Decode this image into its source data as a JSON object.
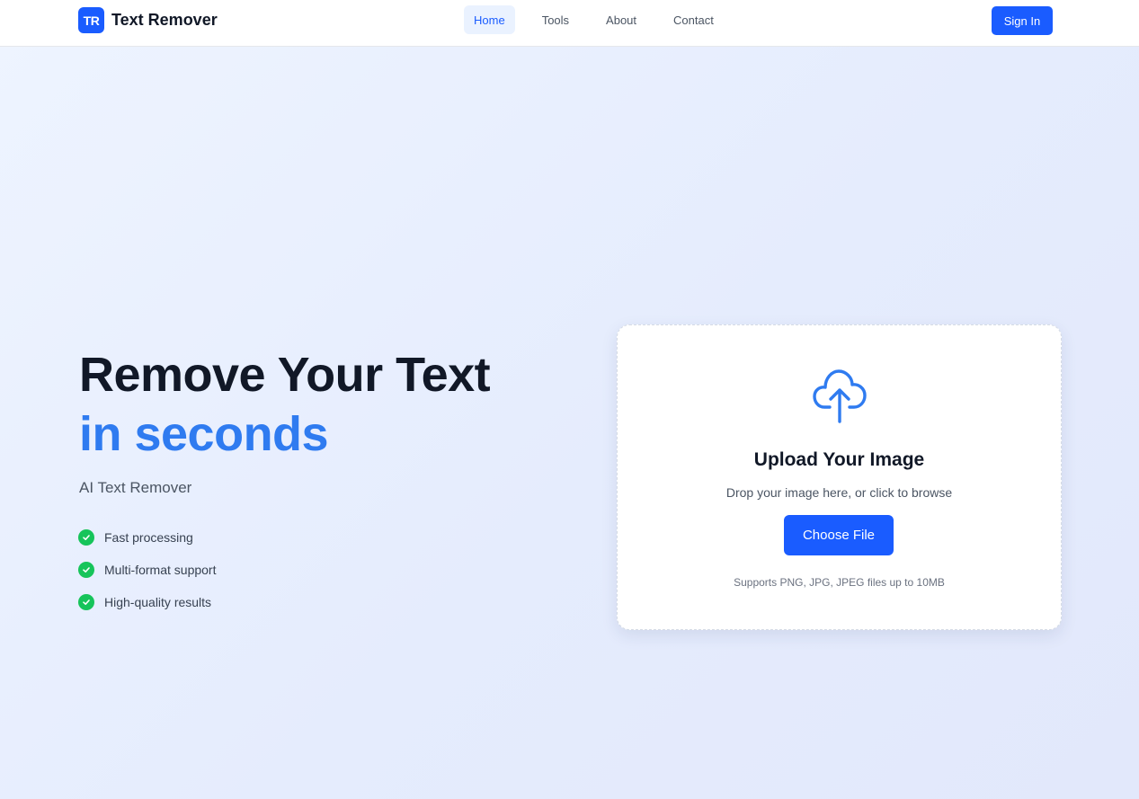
{
  "header": {
    "logo_text": "TR",
    "brand_name": "Text Remover",
    "nav": [
      {
        "label": "Home",
        "active": true
      },
      {
        "label": "Tools",
        "active": false
      },
      {
        "label": "About",
        "active": false
      },
      {
        "label": "Contact",
        "active": false
      }
    ],
    "signin_label": "Sign In"
  },
  "hero": {
    "title_line1": "Remove Your Text",
    "title_line2": "in seconds",
    "subtitle": "AI Text Remover",
    "features": [
      {
        "label": "Fast processing",
        "icon": "check-circle-icon"
      },
      {
        "label": "Multi-format support",
        "icon": "check-circle-icon"
      },
      {
        "label": "High-quality results",
        "icon": "check-circle-icon"
      }
    ]
  },
  "upload": {
    "icon": "cloud-upload-icon",
    "title": "Upload Your Image",
    "hint": "Drop your image here, or click to browse",
    "button_label": "Choose File",
    "note": "Supports PNG, JPG, JPEG files up to 10MB"
  },
  "colors": {
    "primary": "#1a5cff",
    "accent_text": "#2f7bf0",
    "success": "#16c45a",
    "nav_active_bg": "#eaf2ff"
  }
}
